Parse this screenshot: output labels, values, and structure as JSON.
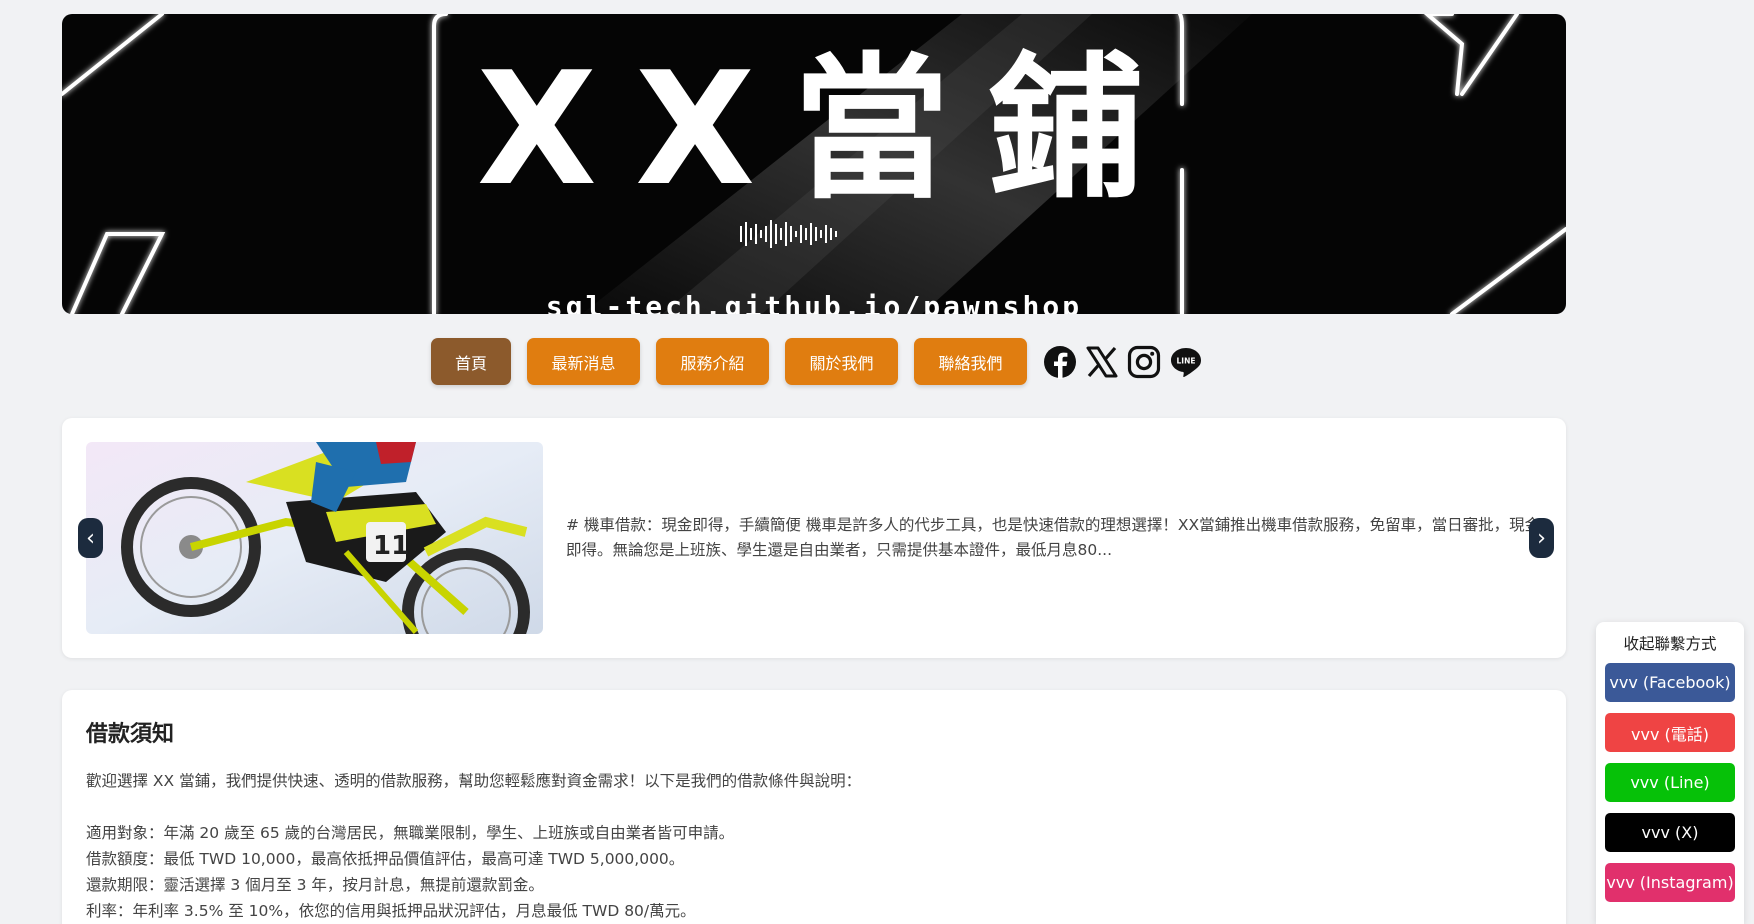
{
  "banner": {
    "title": "XX當鋪",
    "url": "sql-tech.github.io/pawnshop"
  },
  "nav": {
    "items": [
      {
        "label": "首頁",
        "active": true
      },
      {
        "label": "最新消息"
      },
      {
        "label": "服務介紹"
      },
      {
        "label": "關於我們"
      },
      {
        "label": "聯絡我們"
      }
    ],
    "social_icons": [
      "facebook-icon",
      "x-icon",
      "instagram-icon",
      "line-icon"
    ]
  },
  "carousel": {
    "text": "# 機車借款：現金即得，手續簡便 機車是許多人的代步工具，也是快速借款的理想選擇！XX當鋪推出機車借款服務，免留車，當日審批，現金即得。無論您是上班族、學生還是自由業者，只需提供基本證件，最低月息80...",
    "prev_icon": "‹",
    "next_icon": "›"
  },
  "notice": {
    "title": "借款須知",
    "intro": "歡迎選擇 XX 當鋪，我們提供快速、透明的借款服務，幫助您輕鬆應對資金需求！以下是我們的借款條件與說明：",
    "items": [
      "適用對象：年滿 20 歲至 65 歲的台灣居民，無職業限制，學生、上班族或自由業者皆可申請。",
      "借款額度：最低 TWD 10,000，最高依抵押品價值評估，最高可達 TWD 5,000,000。",
      "還款期限：靈活選擇 3 個月至 3 年，按月計息，無提前還款罰金。",
      "利率：年利率 3.5% 至 10%，依您的信用與抵押品狀況評估，月息最低 TWD 80/萬元。"
    ]
  },
  "contact": {
    "collapse_label": "收起聯繫方式",
    "buttons": [
      {
        "label": "vvv (Facebook)",
        "color": "#3b5998"
      },
      {
        "label": "vvv (電話)",
        "color": "#ef4444"
      },
      {
        "label": "vvv (Line)",
        "color": "#06c108"
      },
      {
        "label": "vvv (X)",
        "color": "#000000"
      },
      {
        "label": "vvv (Instagram)",
        "color": "#e1306c"
      }
    ]
  }
}
